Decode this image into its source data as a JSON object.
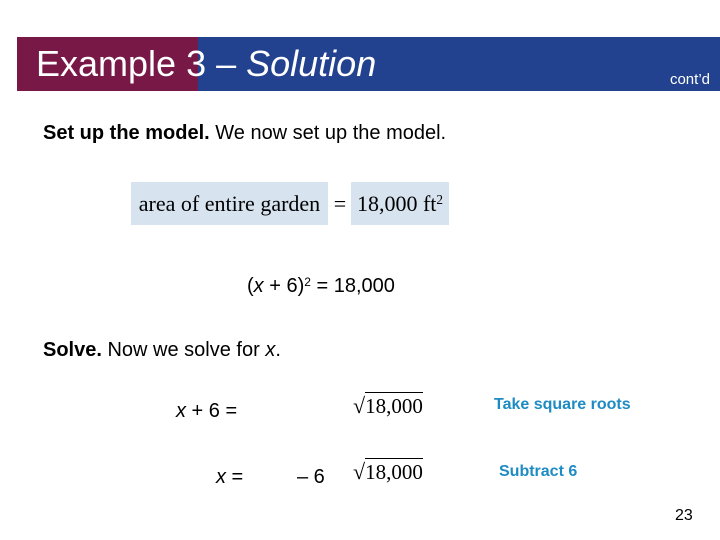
{
  "header": {
    "title_plain": "Example",
    "title_number": " 3 – ",
    "title_italic": "Solution",
    "contd": "cont’d",
    "colors": {
      "maroon": "#771847",
      "blue": "#22418f"
    }
  },
  "setup": {
    "label": "Set up the model.",
    "text": " We now set up the model."
  },
  "model_equation": {
    "left": "area of entire garden",
    "equals": "=",
    "right": "18,000 ft",
    "right_exponent": "2"
  },
  "equation1": {
    "open": "(",
    "var": "x",
    "rest": " + 6)",
    "exponent": "2",
    "tail": " = 18,000"
  },
  "solve": {
    "label": "Solve.",
    "text": " Now we solve for ",
    "var": "x",
    "end": "."
  },
  "steps": [
    {
      "lhs_var": "x",
      "lhs_rest": " + 6 =",
      "prefix": "",
      "radicand": "18,000",
      "note": "Take square roots"
    },
    {
      "lhs_var": "x",
      "lhs_rest": " =",
      "prefix": "– 6",
      "radicand": "18,000",
      "note": "Subtract 6"
    }
  ],
  "note_color": "#1e8bc3",
  "page_number": "23"
}
